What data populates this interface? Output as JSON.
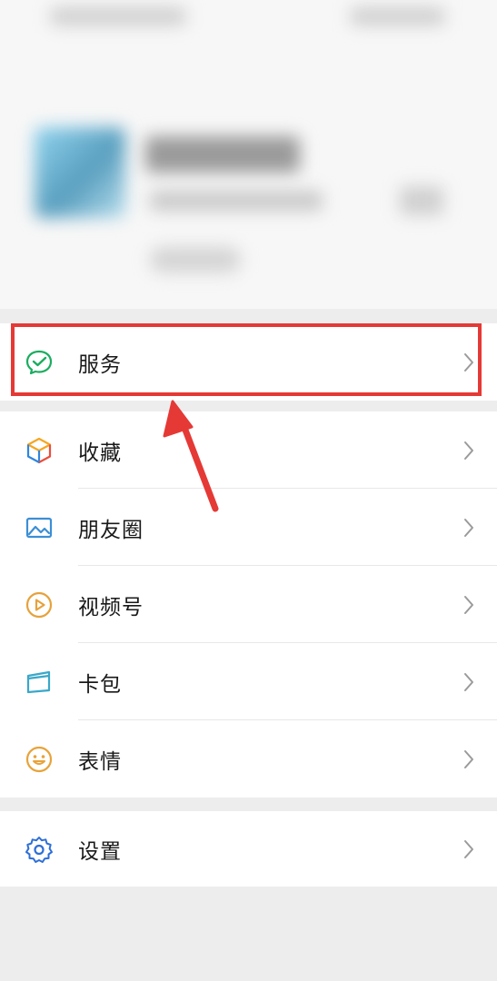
{
  "menu_groups": {
    "services": [
      {
        "label": "服务",
        "icon": "wechat-pay-icon"
      }
    ],
    "main": [
      {
        "label": "收藏",
        "icon": "cube-icon"
      },
      {
        "label": "朋友圈",
        "icon": "image-icon"
      },
      {
        "label": "视频号",
        "icon": "play-circle-icon"
      },
      {
        "label": "卡包",
        "icon": "card-icon"
      },
      {
        "label": "表情",
        "icon": "smile-icon"
      }
    ],
    "settings": [
      {
        "label": "设置",
        "icon": "gear-icon"
      }
    ]
  },
  "colors": {
    "highlight": "#e53935",
    "wechat_green": "#1aad5f",
    "cube_yellow": "#f5a623",
    "cube_blue": "#2e86de",
    "image_blue": "#3b8fd6",
    "channels_orange": "#e6a23c",
    "card_teal": "#3aa7c9",
    "smile_yellow": "#e8a33a",
    "gear_blue": "#2d6fd6"
  }
}
